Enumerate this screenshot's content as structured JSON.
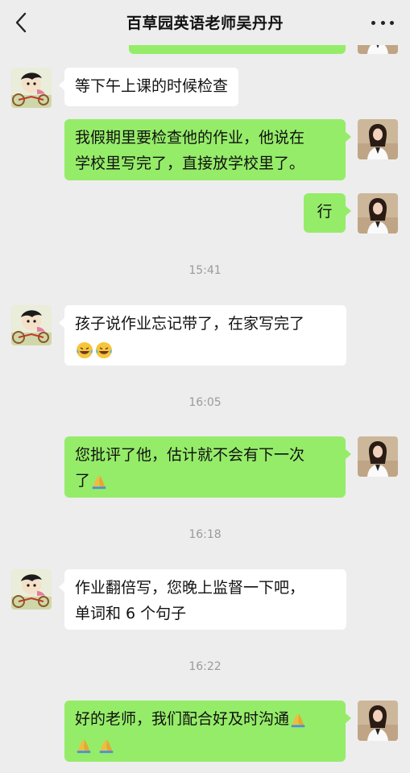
{
  "header": {
    "title": "百草园英语老师吴丹丹",
    "back_icon": "chevron-left-icon",
    "more_icon": "more-dots-icon"
  },
  "colors": {
    "background": "#ededed",
    "sent_bubble": "#95ec69",
    "received_bubble": "#ffffff",
    "timestamp": "#9a9a9a"
  },
  "messages": [
    {
      "type": "sent",
      "text": ""
    },
    {
      "type": "received",
      "text": "等下午上课的时候检查"
    },
    {
      "type": "sent",
      "lines": [
        "我假期里要检查他的作业，他说在",
        "学校里写完了，直接放学校里了。"
      ]
    },
    {
      "type": "sent",
      "text": "行"
    },
    {
      "type": "time",
      "text": "15:41"
    },
    {
      "type": "received",
      "lines": [
        "孩子说作业忘记带了，在家写完了",
        ""
      ],
      "emoji": [
        "laughing-tears-emoji",
        "laughing-tears-emoji"
      ]
    },
    {
      "type": "time",
      "text": "16:05"
    },
    {
      "type": "sent",
      "lines": [
        "您批评了他，估计就不会有下一次",
        "了"
      ],
      "emoji": [
        "praying-hands-emoji"
      ]
    },
    {
      "type": "time",
      "text": "16:18"
    },
    {
      "type": "received",
      "lines": [
        "作业翻倍写，您晚上监督一下吧，",
        "单词和 6 个句子"
      ]
    },
    {
      "type": "time",
      "text": "16:22"
    },
    {
      "type": "sent",
      "lines": [
        "好的老师，我们配合好及时沟通",
        ""
      ],
      "emoji": [
        "praying-hands-emoji",
        "praying-hands-emoji",
        "praying-hands-emoji"
      ]
    }
  ],
  "avatars": {
    "received": "cartoon-child-on-tricycle-avatar",
    "sent": "woman-in-white-jacket-avatar"
  }
}
